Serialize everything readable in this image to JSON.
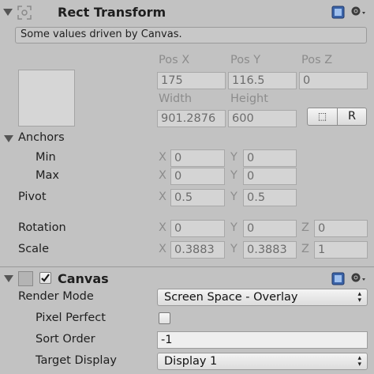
{
  "rect_transform": {
    "title": "Rect Transform",
    "driven_notice": "Some values driven by Canvas.",
    "pos_x_label": "Pos X",
    "pos_y_label": "Pos Y",
    "pos_z_label": "Pos Z",
    "pos_x": "175",
    "pos_y": "116.5",
    "pos_z": "0",
    "width_label": "Width",
    "height_label": "Height",
    "width": "901.2876",
    "height": "600",
    "blueprint_button": "⬚",
    "raw_button": "R",
    "anchors_label": "Anchors",
    "min_label": "Min",
    "max_label": "Max",
    "min_x": "0",
    "min_y": "0",
    "max_x": "0",
    "max_y": "0",
    "pivot_label": "Pivot",
    "pivot_x": "0.5",
    "pivot_y": "0.5",
    "rotation_label": "Rotation",
    "rotation_x": "0",
    "rotation_y": "0",
    "rotation_z": "0",
    "scale_label": "Scale",
    "scale_x": "0.3883",
    "scale_y": "0.3883",
    "scale_z": "1",
    "x_letter": "X",
    "y_letter": "Y",
    "z_letter": "Z"
  },
  "canvas": {
    "title": "Canvas",
    "enabled": true,
    "render_mode_label": "Render Mode",
    "render_mode_value": "Screen Space - Overlay",
    "pixel_perfect_label": "Pixel Perfect",
    "pixel_perfect": false,
    "sort_order_label": "Sort Order",
    "sort_order": "-1",
    "target_display_label": "Target Display",
    "target_display_value": "Display 1"
  },
  "icons": {
    "help": "help-book-icon",
    "settings": "gear-icon",
    "foldout": "triangle-down-icon"
  },
  "colors": {
    "background": "#c2c2c2",
    "help_icon": "#3a63a8"
  }
}
